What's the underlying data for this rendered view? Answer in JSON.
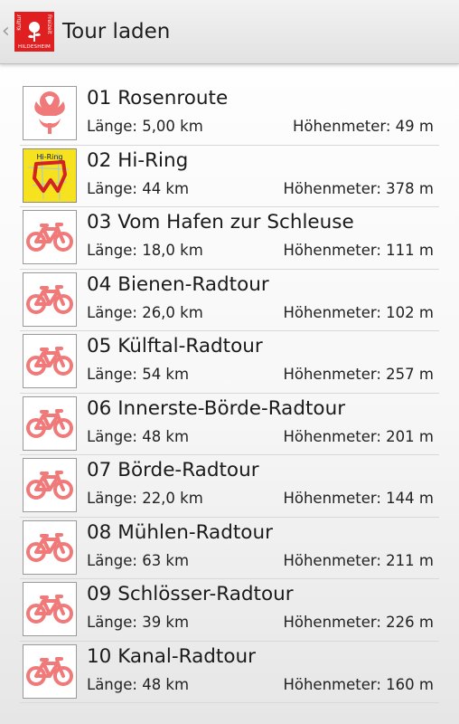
{
  "colors": {
    "accent": "#e02020",
    "bike_icon": "#f07a7a",
    "ring_bg": "#f6e21e"
  },
  "header": {
    "title": "Tour laden",
    "logo": {
      "left": "Kultur",
      "right": "Freizeit",
      "bottom": "HILDESHEIM"
    }
  },
  "tours": [
    {
      "name": "01 Rosenroute",
      "length": "Länge: 5,00 km",
      "elevation": "Höhenmeter: 49 m",
      "icon": "rose-icon"
    },
    {
      "name": "02 Hi-Ring",
      "length": "Länge: 44 km",
      "elevation": "Höhenmeter: 378 m",
      "icon": "hi-ring-map-icon",
      "icon_label": "Hi-Ring"
    },
    {
      "name": "03 Vom Hafen zur Schleuse",
      "length": "Länge: 18,0 km",
      "elevation": "Höhenmeter: 111 m",
      "icon": "bicycle-icon"
    },
    {
      "name": "04 Bienen-Radtour",
      "length": "Länge: 26,0 km",
      "elevation": "Höhenmeter: 102 m",
      "icon": "bicycle-icon"
    },
    {
      "name": "05 Külftal-Radtour",
      "length": "Länge: 54 km",
      "elevation": "Höhenmeter: 257 m",
      "icon": "bicycle-icon"
    },
    {
      "name": "06 Innerste-Börde-Radtour",
      "length": "Länge: 48 km",
      "elevation": "Höhenmeter: 201 m",
      "icon": "bicycle-icon"
    },
    {
      "name": "07 Börde-Radtour",
      "length": "Länge: 22,0 km",
      "elevation": "Höhenmeter: 144 m",
      "icon": "bicycle-icon"
    },
    {
      "name": "08 Mühlen-Radtour",
      "length": "Länge: 63 km",
      "elevation": "Höhenmeter: 211 m",
      "icon": "bicycle-icon"
    },
    {
      "name": "09 Schlösser-Radtour",
      "length": "Länge: 39 km",
      "elevation": "Höhenmeter: 226 m",
      "icon": "bicycle-icon"
    },
    {
      "name": "10 Kanal-Radtour",
      "length": "Länge: 48 km",
      "elevation": "Höhenmeter: 160 m",
      "icon": "bicycle-icon"
    }
  ]
}
